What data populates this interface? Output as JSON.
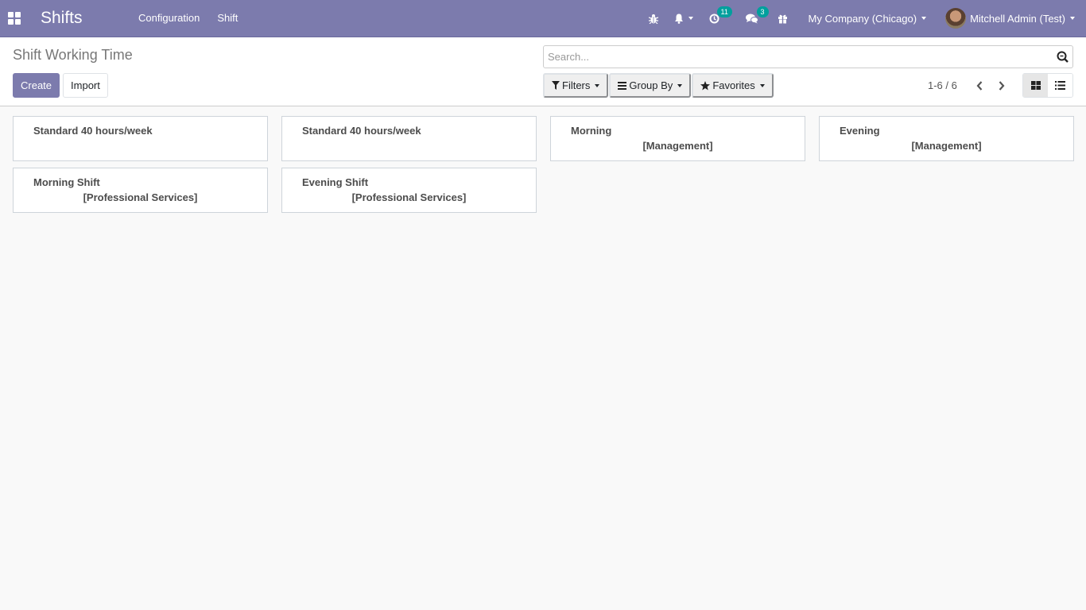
{
  "navbar": {
    "app_name": "Shifts",
    "menu": [
      {
        "label": "Configuration"
      },
      {
        "label": "Shift"
      }
    ],
    "systray": {
      "debug_icon": "bug-icon",
      "notifications_icon": "bell-icon",
      "activities_icon": "clock-icon",
      "activities_count": "11",
      "messages_icon": "comments-icon",
      "messages_count": "3",
      "gift_icon": "gift-icon",
      "company": "My Company (Chicago)",
      "user": "Mitchell Admin (Test)"
    },
    "colors": {
      "brand": "#7c7bad",
      "badge": "#00a09d"
    }
  },
  "control_panel": {
    "breadcrumb": "Shift Working Time",
    "create_label": "Create",
    "import_label": "Import",
    "search_placeholder": "Search...",
    "search_value": "",
    "filters_label": "Filters",
    "group_by_label": "Group By",
    "favorites_label": "Favorites",
    "pager": "1-6 / 6",
    "views": [
      {
        "name": "kanban",
        "active": true
      },
      {
        "name": "list",
        "active": false
      }
    ]
  },
  "kanban": {
    "records": [
      {
        "name": "Standard 40 hours/week",
        "team": ""
      },
      {
        "name": "Standard 40 hours/week",
        "team": ""
      },
      {
        "name": "Morning",
        "team": "[Management]"
      },
      {
        "name": "Evening",
        "team": "[Management]"
      },
      {
        "name": "Morning Shift",
        "team": "[Professional Services]"
      },
      {
        "name": "Evening Shift",
        "team": "[Professional Services]"
      }
    ]
  }
}
